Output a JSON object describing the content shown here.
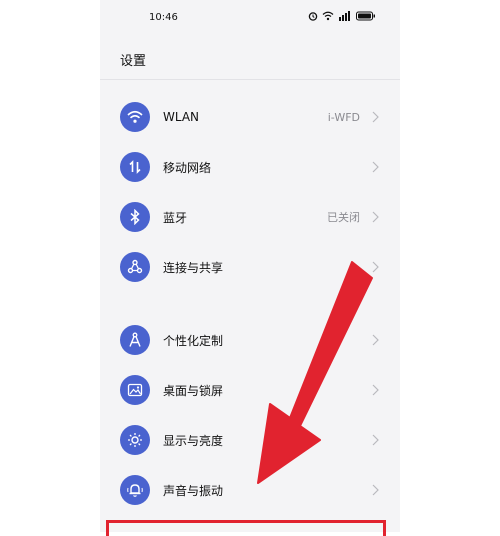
{
  "status_bar": {
    "time": "10:46",
    "icons": [
      "alarm-icon",
      "wifi-icon",
      "signal-icon",
      "battery-icon"
    ]
  },
  "header": {
    "title": "设置"
  },
  "group1": [
    {
      "label": "WLAN",
      "value": "i-WFD",
      "icon": "wifi-icon"
    },
    {
      "label": "移动网络",
      "value": "",
      "icon": "mobile-data-icon"
    },
    {
      "label": "蓝牙",
      "value": "已关闭",
      "icon": "bluetooth-icon"
    },
    {
      "label": "连接与共享",
      "value": "",
      "icon": "share-icon"
    }
  ],
  "group2": [
    {
      "label": "个性化定制",
      "value": "",
      "icon": "compass-icon"
    },
    {
      "label": "桌面与锁屏",
      "value": "",
      "icon": "image-icon"
    },
    {
      "label": "显示与亮度",
      "value": "",
      "icon": "sun-icon"
    },
    {
      "label": "声音与振动",
      "value": "",
      "icon": "bell-icon"
    }
  ],
  "colors": {
    "icon_bg": "#4a63cf",
    "annotation_red": "#e1232f"
  }
}
